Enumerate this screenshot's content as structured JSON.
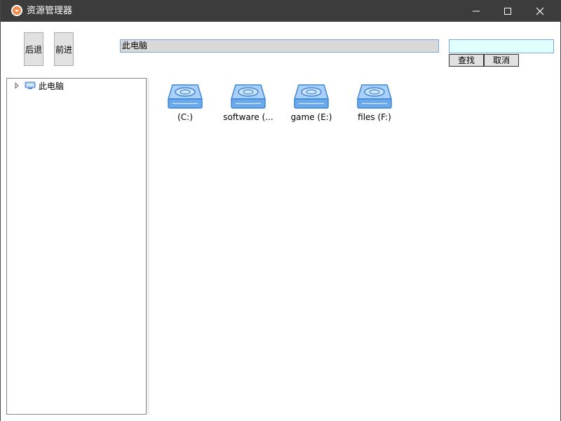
{
  "window": {
    "title": "资源管理器",
    "app_icon": "app-logo-icon",
    "controls": {
      "minimize": "minimize-icon",
      "maximize": "maximize-icon",
      "close": "close-icon"
    }
  },
  "toolbar": {
    "back_label": "后退",
    "forward_label": "前进",
    "address_value": "此电脑",
    "search_value": "",
    "find_label": "查找",
    "cancel_label": "取消"
  },
  "tree": {
    "items": [
      {
        "label": "此电脑",
        "icon": "computer-icon",
        "expander": "expand-arrow-icon"
      }
    ]
  },
  "content": {
    "drives": [
      {
        "label": "(C:)",
        "icon": "hard-drive-icon"
      },
      {
        "label": "software (...",
        "icon": "hard-drive-icon"
      },
      {
        "label": "game (E:)",
        "icon": "hard-drive-icon"
      },
      {
        "label": "files (F:)",
        "icon": "hard-drive-icon"
      }
    ]
  },
  "colors": {
    "titlebar": "#3c3c3c",
    "address_bg": "#d9d9d9",
    "search_bg": "#e0ffff",
    "drive_blue": "#5a9be0"
  }
}
